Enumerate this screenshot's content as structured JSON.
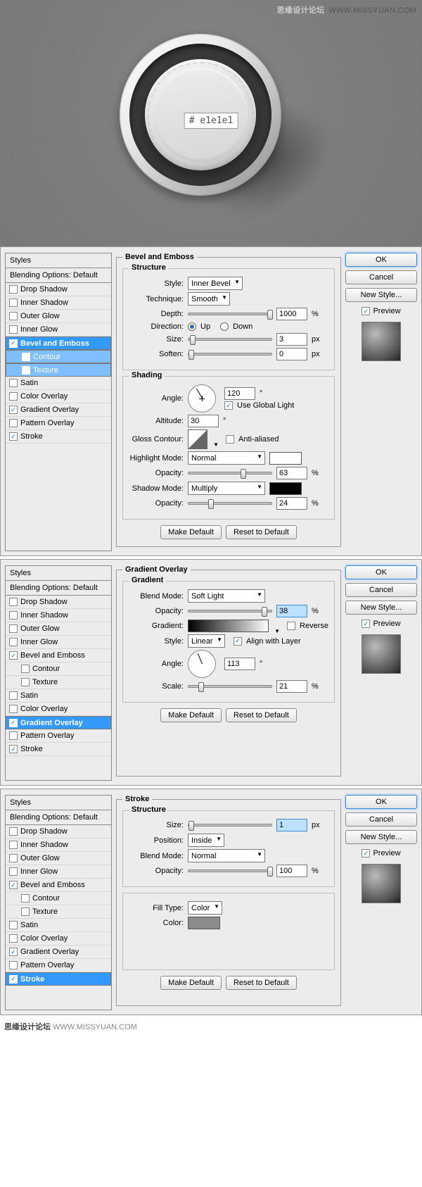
{
  "hero": {
    "watermark_site": "思缘设计论坛",
    "watermark_url": "WWW.MISSYUAN.COM",
    "hex_label": "# e1e1e1"
  },
  "common": {
    "styles_header": "Styles",
    "blending_header": "Blending Options: Default",
    "items": [
      "Drop Shadow",
      "Inner Shadow",
      "Outer Glow",
      "Inner Glow",
      "Bevel and Emboss",
      "Contour",
      "Texture",
      "Satin",
      "Color Overlay",
      "Gradient Overlay",
      "Pattern Overlay",
      "Stroke"
    ],
    "make_default": "Make Default",
    "reset_default": "Reset to Default",
    "ok": "OK",
    "cancel": "Cancel",
    "new_style": "New Style...",
    "preview": "Preview"
  },
  "panel1": {
    "title": "Bevel and Emboss",
    "structure": "Structure",
    "style_lbl": "Style:",
    "style_val": "Inner Bevel",
    "technique_lbl": "Technique:",
    "technique_val": "Smooth",
    "depth_lbl": "Depth:",
    "depth_val": "1000",
    "pct": "%",
    "direction_lbl": "Direction:",
    "up": "Up",
    "down": "Down",
    "size_lbl": "Size:",
    "size_val": "3",
    "px": "px",
    "soften_lbl": "Soften:",
    "soften_val": "0",
    "shading": "Shading",
    "angle_lbl": "Angle:",
    "angle_val": "120",
    "deg": "°",
    "global": "Use Global Light",
    "altitude_lbl": "Altitude:",
    "altitude_val": "30",
    "gloss_lbl": "Gloss Contour:",
    "anti": "Anti-aliased",
    "hmode_lbl": "Highlight Mode:",
    "hmode_val": "Normal",
    "opacity_lbl": "Opacity:",
    "hop_val": "63",
    "smode_lbl": "Shadow Mode:",
    "smode_val": "Multiply",
    "sop_val": "24",
    "checked": {
      "Bevel and Emboss": true,
      "Gradient Overlay": true,
      "Stroke": true
    },
    "selected": [
      "Bevel and Emboss",
      "Contour",
      "Texture"
    ]
  },
  "panel2": {
    "title": "Gradient Overlay",
    "group": "Gradient",
    "blend_lbl": "Blend Mode:",
    "blend_val": "Soft Light",
    "opacity_lbl": "Opacity:",
    "op_val": "38",
    "pct": "%",
    "gradient_lbl": "Gradient:",
    "reverse": "Reverse",
    "style_lbl": "Style:",
    "style_val": "Linear",
    "align": "Align with Layer",
    "angle_lbl": "Angle:",
    "angle_val": "113",
    "deg": "°",
    "scale_lbl": "Scale:",
    "scale_val": "21",
    "checked": {
      "Bevel and Emboss": true,
      "Gradient Overlay": true,
      "Stroke": true
    },
    "selected": [
      "Gradient Overlay"
    ]
  },
  "panel3": {
    "title": "Stroke",
    "structure": "Structure",
    "size_lbl": "Size:",
    "size_val": "1",
    "px": "px",
    "pos_lbl": "Position:",
    "pos_val": "Inside",
    "blend_lbl": "Blend Mode:",
    "blend_val": "Normal",
    "opacity_lbl": "Opacity:",
    "op_val": "100",
    "pct": "%",
    "fill_lbl": "Fill Type:",
    "fill_val": "Color",
    "color_lbl": "Color:",
    "color_val": "#8c8c8c",
    "checked": {
      "Bevel and Emboss": true,
      "Gradient Overlay": true,
      "Stroke": true
    },
    "selected": [
      "Stroke"
    ]
  },
  "footer": {
    "site": "思缘设计论坛",
    "url": "WWW.MISSYUAN.COM"
  }
}
